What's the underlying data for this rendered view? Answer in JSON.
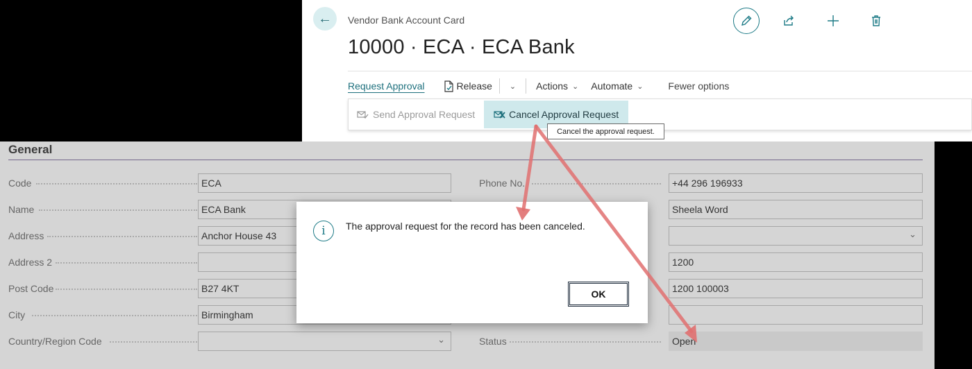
{
  "card": {
    "caption": "Vendor Bank Account Card",
    "title": "10000 · ECA · ECA Bank"
  },
  "toolbar_icons": [
    "pencil-icon",
    "share-icon",
    "plus-icon",
    "trash-icon"
  ],
  "actions": {
    "request_approval": "Request Approval",
    "release": "Release",
    "actions": "Actions",
    "automate": "Automate",
    "fewer_options": "Fewer options"
  },
  "submenu": {
    "send": "Send Approval Request",
    "cancel": "Cancel Approval Request"
  },
  "tooltip": "Cancel the approval request.",
  "section": {
    "title": "General",
    "left_fields": [
      {
        "label": "Code",
        "value": "ECA"
      },
      {
        "label": "Name",
        "value": "ECA Bank"
      },
      {
        "label": "Address",
        "value": "Anchor House 43"
      },
      {
        "label": "Address 2",
        "value": ""
      },
      {
        "label": "Post Code",
        "value": "B27 4KT"
      },
      {
        "label": "City",
        "value": "Birmingham"
      },
      {
        "label": "Country/Region Code",
        "value": ""
      }
    ],
    "right_fields": [
      {
        "label": "Phone No.",
        "value": "+44 296 196933"
      },
      {
        "label": "",
        "value": "Sheela Word"
      },
      {
        "label": "",
        "value": ""
      },
      {
        "label": "",
        "value": "1200"
      },
      {
        "label": "",
        "value": "1200 100003"
      },
      {
        "label": "",
        "value": ""
      },
      {
        "label": "Status",
        "value": "Open"
      }
    ]
  },
  "dialog": {
    "message": "The approval request for the record has been canceled.",
    "ok": "OK"
  },
  "colors": {
    "accent": "#1c7a86",
    "annotation_arrow": "#e07070",
    "form_background": "#d5d5d5",
    "selected_action": "#cfe9ec"
  }
}
